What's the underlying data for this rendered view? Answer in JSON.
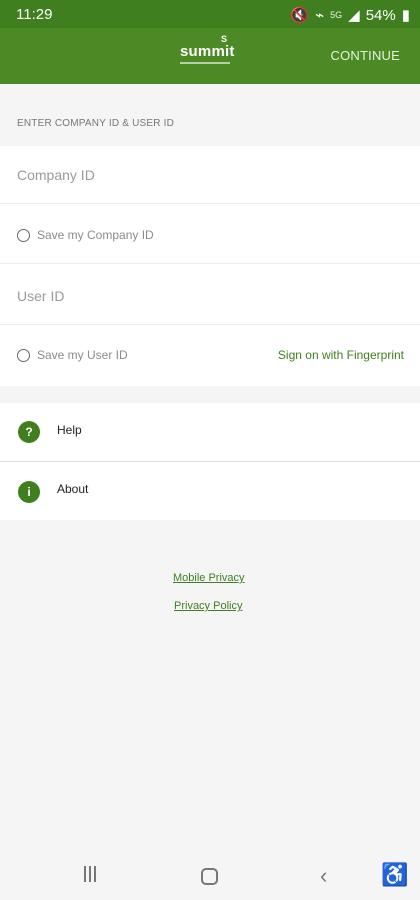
{
  "status": {
    "time": "11:29",
    "network": "5G",
    "battery": "54%"
  },
  "appbar": {
    "logo": "summit",
    "continue": "CONTINUE"
  },
  "form": {
    "section_label": "ENTER COMPANY ID & USER ID",
    "company_placeholder": "Company ID",
    "save_company": "Save my Company ID",
    "user_placeholder": "User ID",
    "save_user": "Save my User ID",
    "fingerprint": "Sign on with Fingerprint"
  },
  "menu": {
    "help": "Help",
    "about": "About"
  },
  "links": {
    "mobile_privacy": "Mobile Privacy",
    "privacy_policy": "Privacy Policy"
  },
  "colors": {
    "brand_green": "#4c8a26",
    "dark_green": "#3f7f1f"
  },
  "icons": [
    "mute-icon",
    "wifi-icon",
    "signal-icon",
    "battery-icon",
    "help-icon",
    "info-icon",
    "recents-icon",
    "home-icon",
    "back-icon",
    "accessibility-icon"
  ]
}
